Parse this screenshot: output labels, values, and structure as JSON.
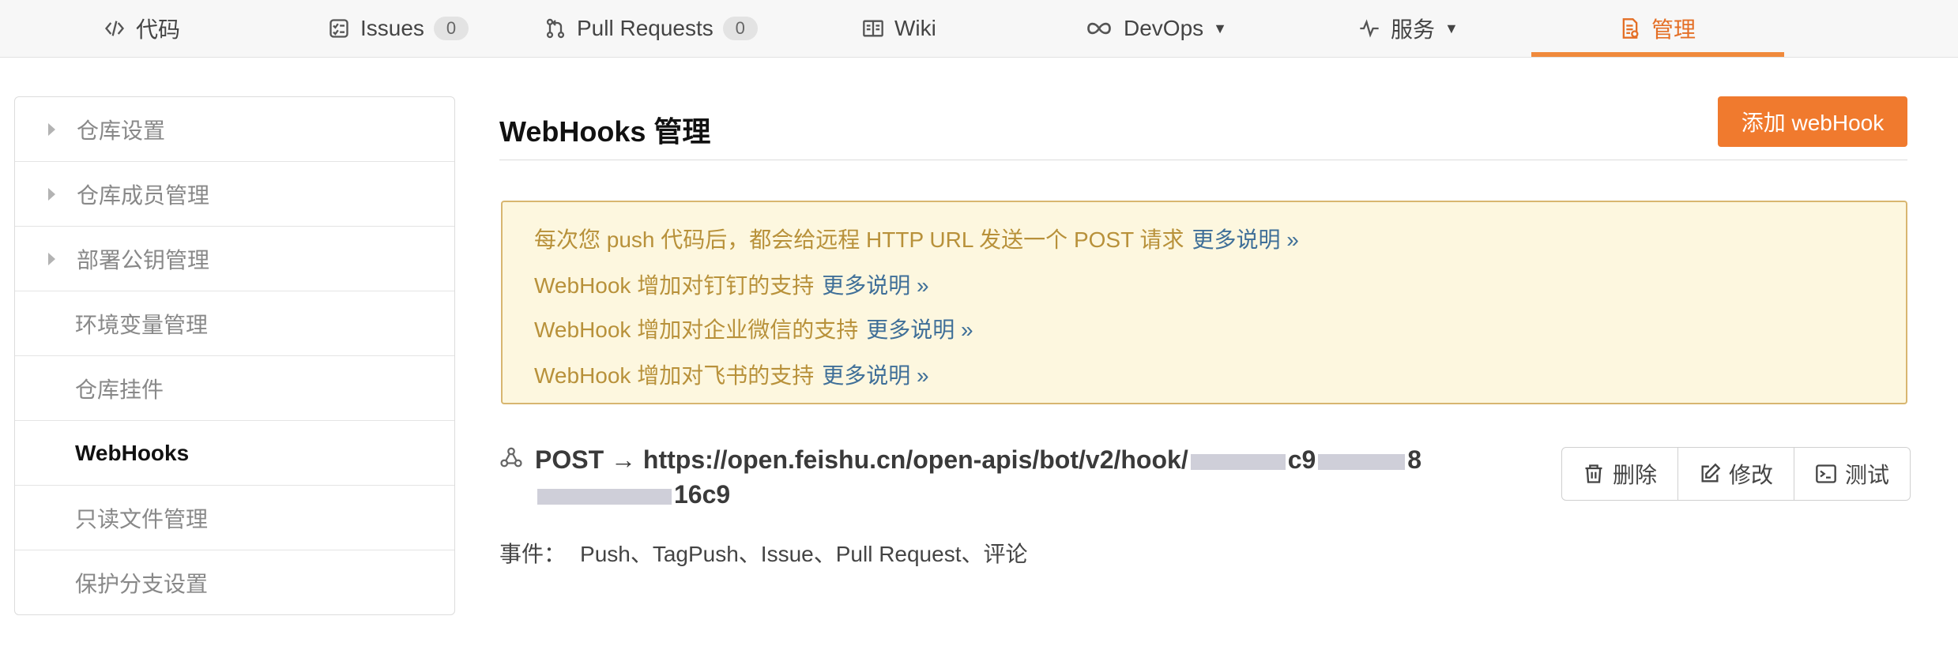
{
  "nav": {
    "tabs": [
      {
        "label": "代码",
        "icon": "code-icon"
      },
      {
        "label": "Issues",
        "icon": "issues-icon",
        "count": "0"
      },
      {
        "label": "Pull Requests",
        "icon": "pull-request-icon",
        "count": "0"
      },
      {
        "label": "Wiki",
        "icon": "wiki-icon"
      },
      {
        "label": "DevOps",
        "icon": "infinity-icon"
      },
      {
        "label": "服务",
        "icon": "pulse-icon"
      },
      {
        "label": "管理",
        "icon": "manage-icon"
      }
    ],
    "active_color": "#e46f26"
  },
  "sidebar": {
    "items": [
      {
        "label": "仓库设置"
      },
      {
        "label": "仓库成员管理"
      },
      {
        "label": "部署公钥管理"
      },
      {
        "label": "环境变量管理"
      },
      {
        "label": "仓库挂件"
      },
      {
        "label": "WebHooks"
      },
      {
        "label": "只读文件管理"
      },
      {
        "label": "保护分支设置"
      }
    ]
  },
  "main": {
    "title": "WebHooks 管理",
    "add_button": "添加 webHook",
    "notice": {
      "lines": [
        {
          "text": "每次您 push 代码后，都会给远程 HTTP URL 发送一个 POST 请求",
          "more": "更多说明 »"
        },
        {
          "text": "WebHook 增加对钉钉的支持",
          "more": "更多说明 »"
        },
        {
          "text": "WebHook 增加对企业微信的支持",
          "more": "更多说明 »"
        },
        {
          "text": "WebHook 增加对飞书的支持",
          "more": "更多说明 »"
        }
      ]
    },
    "hook": {
      "method_prefix": "POST → https://open.feishu.cn/open-apis/bot/v2/hook/",
      "visible_suffix_1": "c9",
      "visible_suffix_2": "8",
      "visible_tail": "16c9",
      "actions": {
        "delete": "删除",
        "edit": "修改",
        "test": "测试"
      },
      "events_label": "事件：",
      "events": "Push、TagPush、Issue、Pull Request、评论"
    }
  },
  "colors": {
    "accent": "#f07a2e",
    "notice_bg": "#fdf7df",
    "notice_border": "#d8b670",
    "notice_text": "#b8913a",
    "link": "#3f6f98"
  }
}
